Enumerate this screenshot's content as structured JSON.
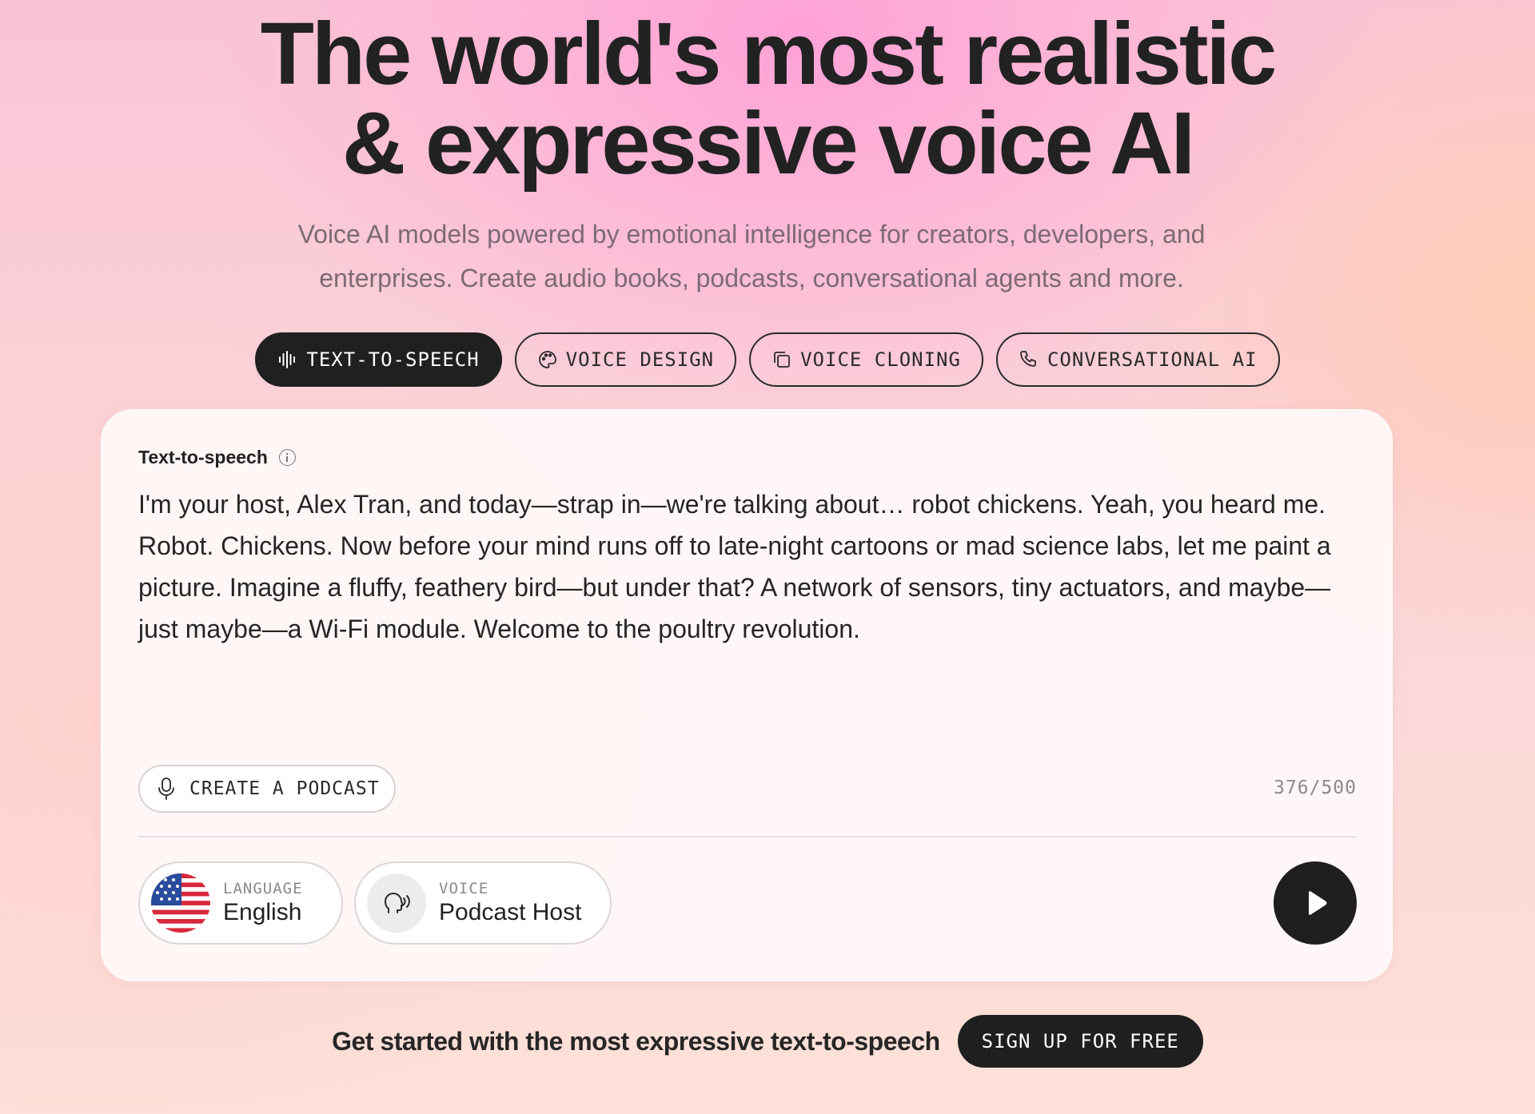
{
  "hero": {
    "title_line1": "The world's most realistic",
    "title_line2": "& expressive voice AI",
    "subtitle_line1": "Voice AI models powered by emotional intelligence for creators, developers, and",
    "subtitle_line2": "enterprises. Create audio books, podcasts, conversational agents and more."
  },
  "tabs": [
    {
      "label": "TEXT-TO-SPEECH",
      "icon": "waveform-icon",
      "active": true
    },
    {
      "label": "VOICE DESIGN",
      "icon": "palette-icon",
      "active": false
    },
    {
      "label": "VOICE CLONING",
      "icon": "copy-icon",
      "active": false
    },
    {
      "label": "CONVERSATIONAL AI",
      "icon": "phone-icon",
      "active": false
    }
  ],
  "card": {
    "label": "Text-to-speech",
    "text": "I'm your host, Alex Tran, and today—strap in—we're talking about… robot chickens. Yeah, you heard me. Robot. Chickens. Now before your mind runs off to late-night cartoons or mad science labs, let me paint a picture. Imagine a fluffy, feathery bird—but under that? A network of sensors, tiny actuators, and maybe—just maybe—a Wi-Fi module. Welcome to the poultry revolution.",
    "podcast_button": "CREATE A PODCAST",
    "char_count": "376/500",
    "language": {
      "label": "LANGUAGE",
      "value": "English",
      "icon": "us-flag-icon"
    },
    "voice": {
      "label": "VOICE",
      "value": "Podcast Host",
      "icon": "speaking-head-icon"
    }
  },
  "cta": {
    "text": "Get started with the most expressive text-to-speech",
    "button": "SIGN UP FOR FREE"
  },
  "colors": {
    "dark": "#1f1f1f",
    "subtitle": "#7d6a74",
    "muted": "#8a8a8a",
    "flag_red": "#d8283b",
    "flag_blue": "#2a4a9c"
  }
}
